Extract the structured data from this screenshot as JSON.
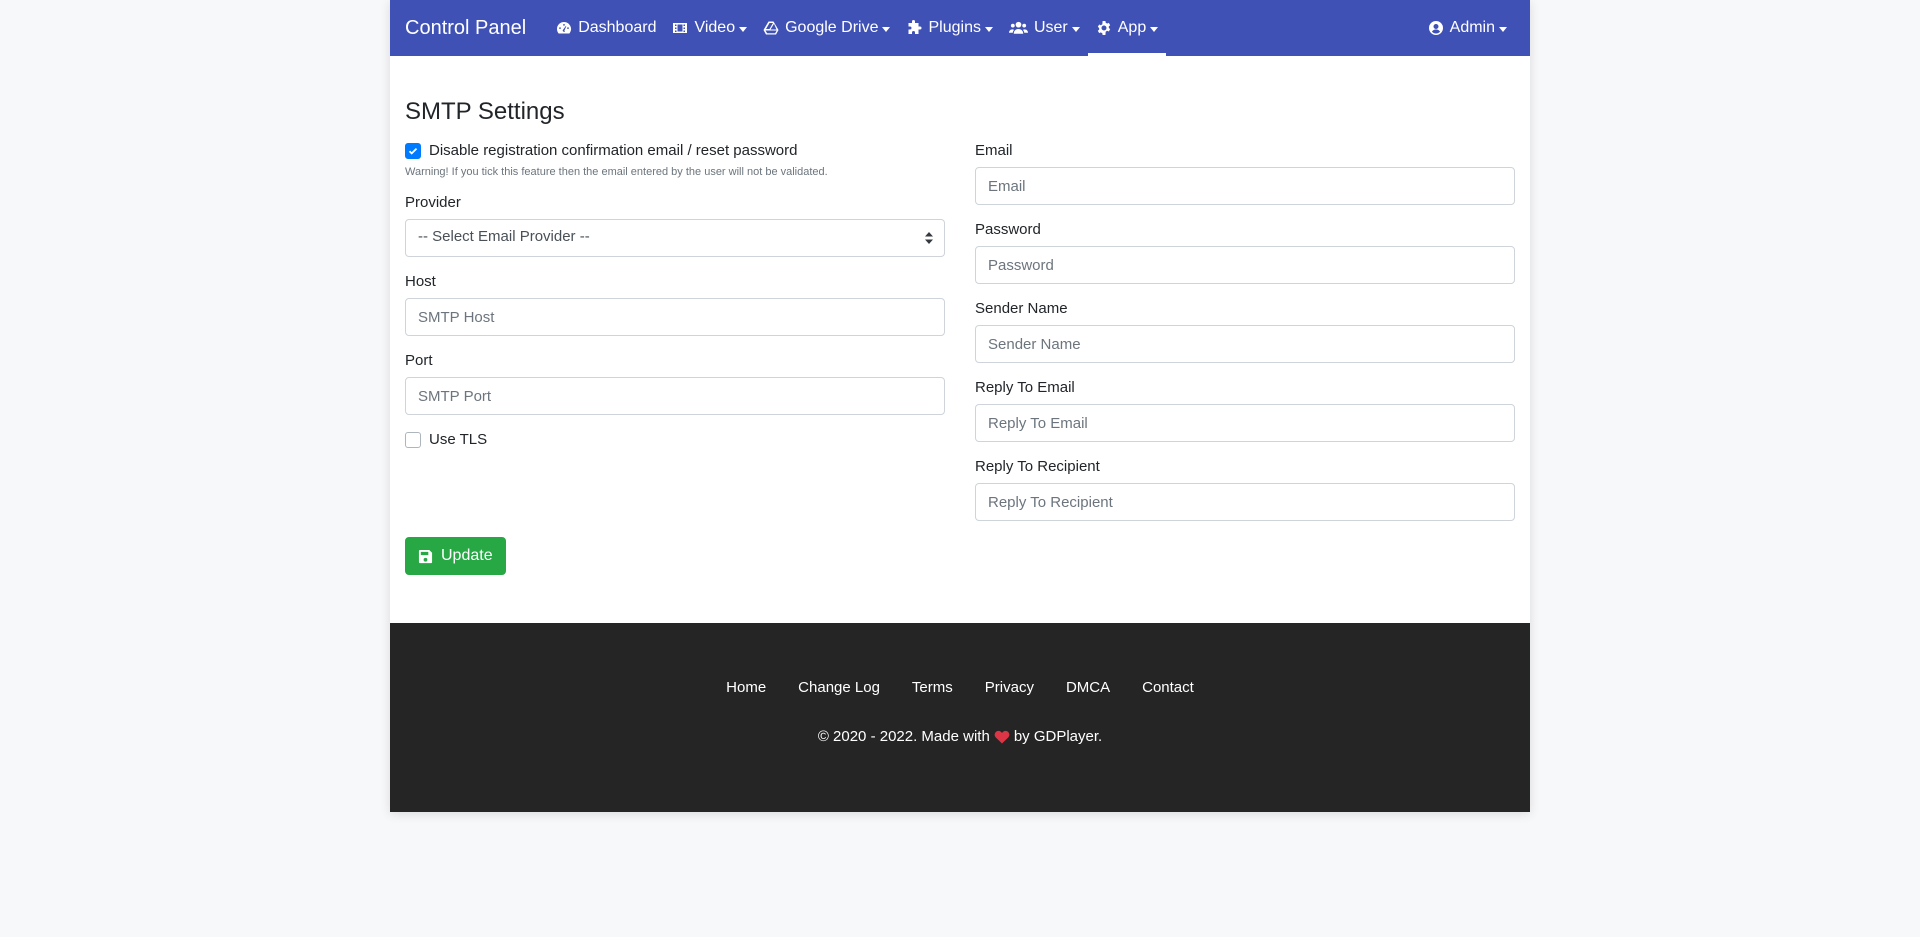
{
  "navbar": {
    "brand": "Control Panel",
    "items": [
      {
        "label": "Dashboard",
        "icon": "tachometer-icon",
        "dropdown": false
      },
      {
        "label": "Video",
        "icon": "film-icon",
        "dropdown": true
      },
      {
        "label": "Google Drive",
        "icon": "google-drive-icon",
        "dropdown": true
      },
      {
        "label": "Plugins",
        "icon": "puzzle-icon",
        "dropdown": true
      },
      {
        "label": "User",
        "icon": "users-icon",
        "dropdown": true
      },
      {
        "label": "App",
        "icon": "gear-icon",
        "dropdown": true,
        "active": true
      }
    ],
    "account": {
      "label": "Admin",
      "icon": "user-circle-icon"
    },
    "color": "#3f51b5"
  },
  "page": {
    "title": "SMTP Settings",
    "disable_confirmation": {
      "label": "Disable registration confirmation email / reset password",
      "checked": true,
      "warning": "Warning! If you tick this feature then the email entered by the user will not be validated."
    },
    "provider": {
      "label": "Provider",
      "selected": "-- Select Email Provider --"
    },
    "host": {
      "label": "Host",
      "placeholder": "SMTP Host",
      "value": ""
    },
    "port": {
      "label": "Port",
      "placeholder": "SMTP Port",
      "value": ""
    },
    "use_tls": {
      "label": "Use TLS",
      "checked": false
    },
    "email": {
      "label": "Email",
      "placeholder": "Email",
      "value": ""
    },
    "password": {
      "label": "Password",
      "placeholder": "Password",
      "value": ""
    },
    "sender_name": {
      "label": "Sender Name",
      "placeholder": "Sender Name",
      "value": ""
    },
    "reply_to_email": {
      "label": "Reply To Email",
      "placeholder": "Reply To Email",
      "value": ""
    },
    "reply_to_recipient": {
      "label": "Reply To Recipient",
      "placeholder": "Reply To Recipient",
      "value": ""
    },
    "update_button": {
      "label": "Update",
      "icon": "save-icon",
      "color": "#28a745"
    }
  },
  "footer": {
    "links": [
      "Home",
      "Change Log",
      "Terms",
      "Privacy",
      "DMCA",
      "Contact"
    ],
    "copyright_prefix": "© 2020 - 2022. Made with",
    "copyright_suffix": "by GDPlayer.",
    "heart_color": "#dc3545",
    "background": "#252525"
  }
}
